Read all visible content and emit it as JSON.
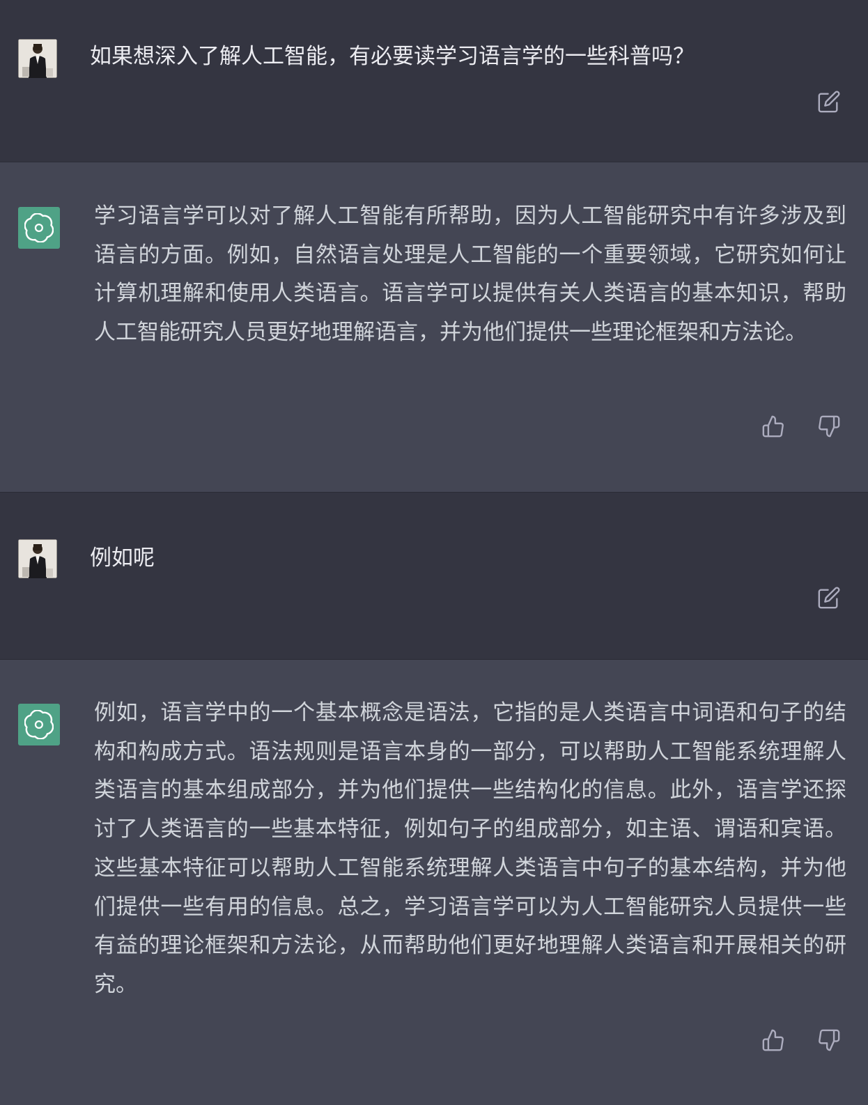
{
  "conversation": {
    "messages": [
      {
        "role": "user",
        "text": "如果想深入了解人工智能，有必要读学习语言学的一些科普吗？",
        "avatar_icon": "user-photo-avatar",
        "actions": [
          "edit-icon"
        ]
      },
      {
        "role": "assistant",
        "text": "学习语言学可以对了解人工智能有所帮助，因为人工智能研究中有许多涉及到语言的方面。例如，自然语言处理是人工智能的一个重要领域，它研究如何让计算机理解和使用人类语言。语言学可以提供有关人类语言的基本知识，帮助人工智能研究人员更好地理解语言，并为他们提供一些理论框架和方法论。",
        "avatar_icon": "openai-logo-icon",
        "actions": [
          "thumbs-up-icon",
          "thumbs-down-icon"
        ]
      },
      {
        "role": "user",
        "text": "例如呢",
        "avatar_icon": "user-photo-avatar",
        "actions": [
          "edit-icon"
        ]
      },
      {
        "role": "assistant",
        "text": "例如，语言学中的一个基本概念是语法，它指的是人类语言中词语和句子的结构和构成方式。语法规则是语言本身的一部分，可以帮助人工智能系统理解人类语言的基本组成部分，并为他们提供一些结构化的信息。此外，语言学还探讨了人类语言的一些基本特征，例如句子的组成部分，如主语、谓语和宾语。这些基本特征可以帮助人工智能系统理解人类语言中句子的基本结构，并为他们提供一些有用的信息。总之，学习语言学可以为人工智能研究人员提供一些有益的理论框架和方法论，从而帮助他们更好地理解人类语言和开展相关的研究。",
        "avatar_icon": "openai-logo-icon",
        "actions": [
          "thumbs-up-icon",
          "thumbs-down-icon"
        ]
      }
    ]
  },
  "colors": {
    "user_bg": "#343541",
    "assistant_bg": "#444654",
    "bot_avatar_bg": "#4fa286",
    "text": "#ececf1",
    "icon": "#acacbe"
  }
}
